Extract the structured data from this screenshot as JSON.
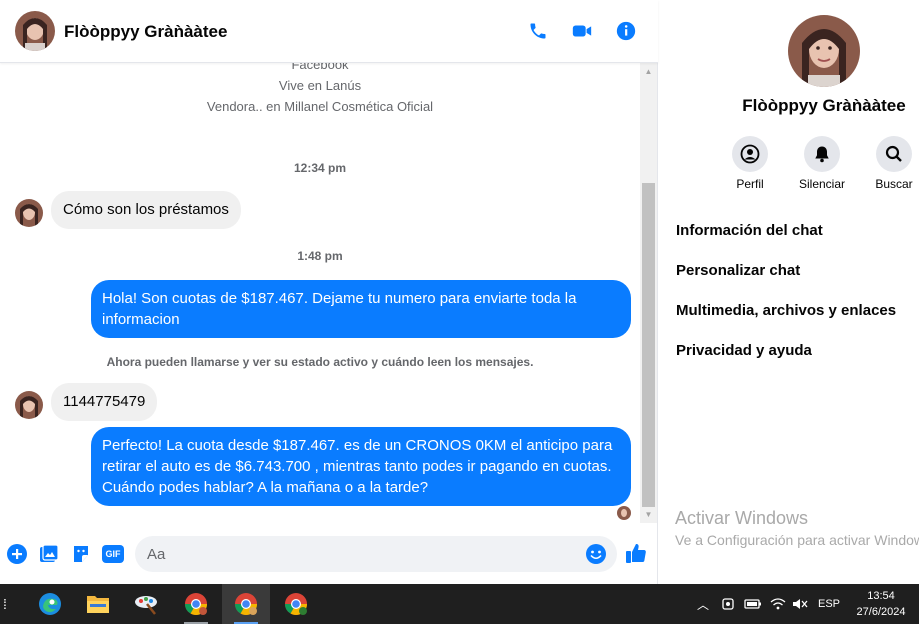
{
  "header": {
    "contact_name": "Flòòppyy Gràǹààtee"
  },
  "intro": {
    "line1": "Facebook",
    "line2": "Vive en Lanús",
    "line3": "Vendora.. en Millanel Cosmética Oficial"
  },
  "messages": {
    "time1": "12:34 pm",
    "incoming1": "Cómo son los préstamos",
    "time2": "1:48 pm",
    "outgoing1": "Hola! Son cuotas de $187.467. Dejame tu numero para enviarte toda la informacion",
    "system": "Ahora pueden llamarse y ver su estado activo y cuándo leen los mensajes.",
    "incoming2": "1144775479",
    "outgoing2": "Perfecto! La cuota desde $187.467. es de un CRONOS 0KM el anticipo para retirar el auto es de $6.743.700 , mientras tanto podes ir pagando en cuotas. Cuándo podes hablar? A la mañana o a la tarde?"
  },
  "composer": {
    "placeholder": "Aa",
    "gif_label": "GIF"
  },
  "side": {
    "name": "Flòòppyy Gràǹààtee",
    "actions": [
      "Perfil",
      "Silenciar",
      "Buscar"
    ],
    "menu": [
      "Información del chat",
      "Personalizar chat",
      "Multimedia, archivos y enlaces",
      "Privacidad y ayuda"
    ],
    "watermark_title": "Activar Windows",
    "watermark_sub": "Ve a Configuración para activar Windows."
  },
  "taskbar": {
    "language": "ESP",
    "time": "13:54",
    "date": "27/6/2024"
  },
  "colors": {
    "accent": "#0a7cff",
    "bubble_in": "#f0f0f0",
    "taskbar": "#1f1f1f"
  }
}
